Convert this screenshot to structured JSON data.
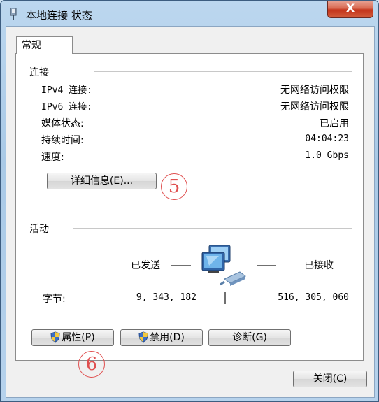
{
  "window": {
    "title": "本地连接 状态",
    "close_glyph": "X"
  },
  "tab": {
    "label": "常规"
  },
  "connection": {
    "heading": "连接",
    "rows": [
      {
        "label": "IPv4 连接:",
        "value": "无网络访问权限"
      },
      {
        "label": "IPv6 连接:",
        "value": "无网络访问权限"
      },
      {
        "label": "媒体状态:",
        "value": "已启用"
      },
      {
        "label": "持续时间:",
        "value": "04:04:23"
      },
      {
        "label": "速度:",
        "value": "1.0 Gbps"
      }
    ],
    "details_button": "详细信息(E)..."
  },
  "activity": {
    "heading": "活动",
    "sent_label": "已发送",
    "received_label": "已接收",
    "bytes_label": "字节:",
    "bytes_sent": "9, 343, 182",
    "bytes_received": "516, 305, 060"
  },
  "buttons": {
    "properties": "属性(P)",
    "disable": "禁用(D)",
    "diagnose": "诊断(G)",
    "close": "关闭(C)"
  },
  "annotations": {
    "five": "5",
    "six": "6"
  },
  "colors": {
    "annotation": "#e05050",
    "titlebar": "#bcd7ef",
    "close_button": "#c3341b"
  }
}
